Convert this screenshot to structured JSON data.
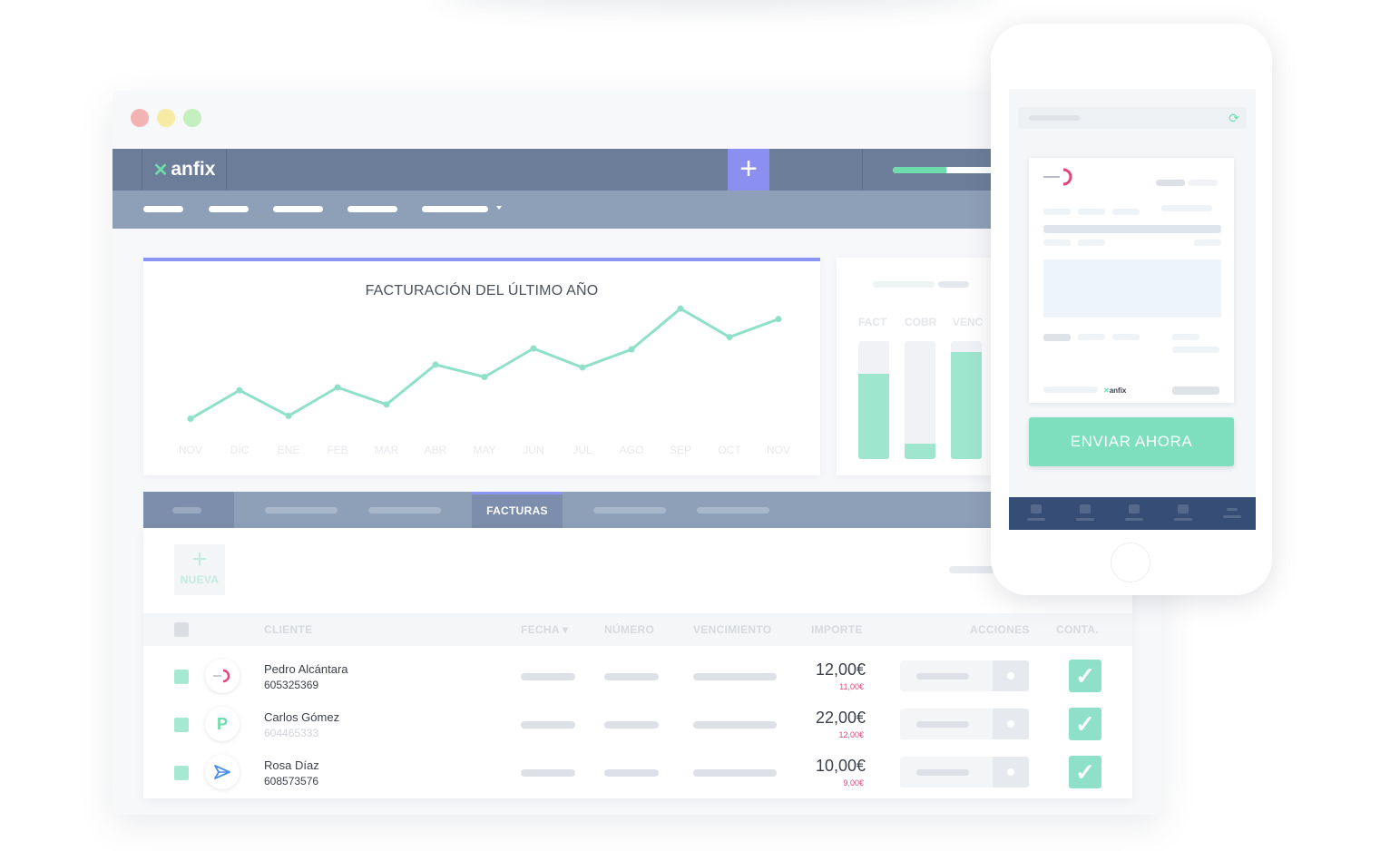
{
  "app": {
    "brand": "anfix",
    "add_symbol": "+",
    "progress": 0.42
  },
  "chart": {
    "title": "FACTURACIÓN DEL ÚLTIMO AÑO",
    "line_color": "#8fe0c8"
  },
  "chart_data": [
    {
      "type": "line",
      "title": "FACTURACIÓN DEL ÚLTIMO AÑO",
      "categories": [
        "NOV",
        "DIC",
        "ENE",
        "FEB",
        "MAR",
        "ABR",
        "MAY",
        "JUN",
        "JUL",
        "AGO",
        "SEP",
        "OCT",
        "NOV"
      ],
      "values": [
        1,
        4,
        1.3,
        4.3,
        2.5,
        6.7,
        5.4,
        8.4,
        6.4,
        8.3,
        12.6,
        9.6,
        11.5
      ],
      "ylim": [
        0,
        13
      ],
      "grid": false
    },
    {
      "type": "bar",
      "categories": [
        "FACT",
        "COBR",
        "VENC"
      ],
      "values": [
        0.72,
        0.13,
        0.91
      ],
      "ylim": [
        0,
        1
      ]
    }
  ],
  "tabs": {
    "active_label": "FACTURAS"
  },
  "invoices": {
    "new_button": {
      "symbol": "+",
      "label": "NUEVA"
    },
    "columns": {
      "cliente": "CLIENTE",
      "fecha": "FECHA ▾",
      "numero": "NÚMERO",
      "vencimiento": "VENCIMIENTO",
      "importe": "IMPORTE",
      "acciones": "ACCIONES",
      "conta": "CONTA."
    },
    "rows": [
      {
        "name": "Pedro Alcántara",
        "phone": "605325369",
        "phone_muted": false,
        "avatar": "logo",
        "amount": "12,00€",
        "sub_amount": "11,00€",
        "check": "✓"
      },
      {
        "name": "Carlos Gómez",
        "phone": "604465333",
        "phone_muted": true,
        "avatar": "P",
        "amount": "22,00€",
        "sub_amount": "12,00€",
        "check": "✓"
      },
      {
        "name": "Rosa Díaz",
        "phone": "608573576",
        "phone_muted": false,
        "avatar": "send",
        "amount": "10,00€",
        "sub_amount": "9,00€",
        "check": "✓"
      }
    ]
  },
  "phone": {
    "refresh_icon": "⟳",
    "brand": "anfix",
    "send_button": "ENVIAR AHORA"
  },
  "colors": {
    "accent": "#8b95f4",
    "brand_green": "#6fdcae",
    "navbar": "#6b7d99",
    "subnav": "#8e9fb8",
    "phone_tabbar": "#364e75",
    "negative": "#e2457c"
  }
}
